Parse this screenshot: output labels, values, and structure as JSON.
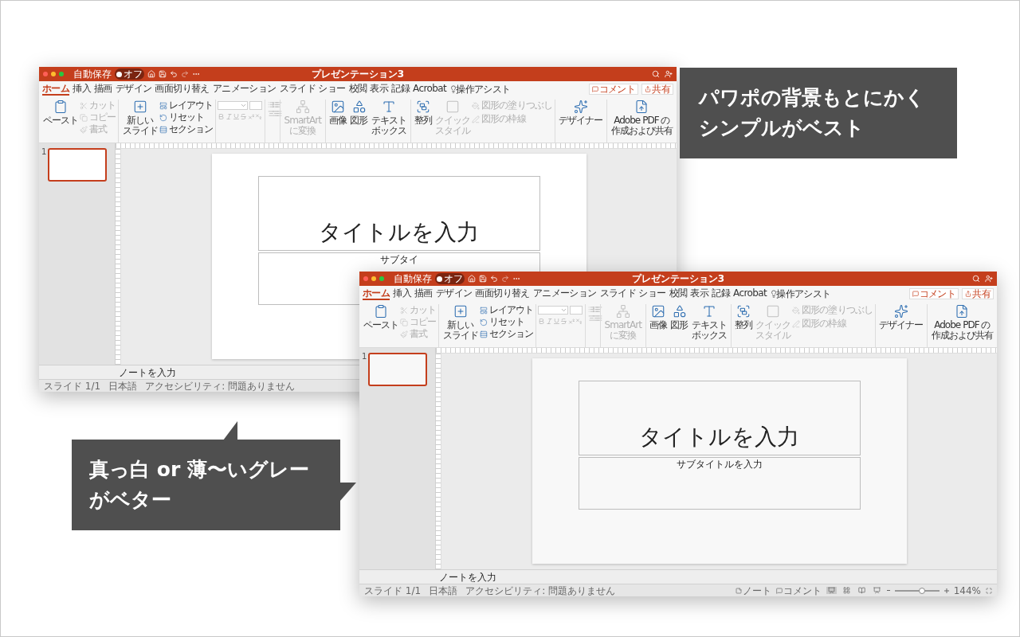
{
  "callouts": [
    {
      "lines": [
        "パワポの背景もとにかく",
        "シンプルがベスト"
      ]
    },
    {
      "lines": [
        "真っ白 or 薄〜いグレー",
        "がベター"
      ]
    }
  ],
  "windows": [
    {
      "title": "プレゼンテーション3",
      "autosave": {
        "label": "自動保存",
        "state": "オフ",
        "on": false
      },
      "tabs": [
        {
          "label": "ホーム",
          "selected": true
        },
        {
          "label": "挿入",
          "selected": false
        },
        {
          "label": "描画",
          "selected": false
        },
        {
          "label": "デザイン",
          "selected": false
        },
        {
          "label": "画面切り替え",
          "selected": false
        },
        {
          "label": "アニメーション",
          "selected": false
        },
        {
          "label": "スライド ショー",
          "selected": false
        },
        {
          "label": "校閲",
          "selected": false
        },
        {
          "label": "表示",
          "selected": false
        },
        {
          "label": "記録",
          "selected": false
        },
        {
          "label": "Acrobat",
          "selected": false
        }
      ],
      "assist": "操作アシスト",
      "comment_button": "コメント",
      "share_button": "共有",
      "ribbon": {
        "paste": {
          "label": "ペースト"
        },
        "clipboard": [
          {
            "label": "カット",
            "disabled": true
          },
          {
            "label": "コピー",
            "disabled": true
          },
          {
            "label": "書式",
            "disabled": true
          }
        ],
        "new_slide": {
          "lines": [
            "新しい",
            "スライド"
          ]
        },
        "slide_tools": [
          {
            "label": "レイアウト",
            "disabled": false
          },
          {
            "label": "リセット",
            "disabled": false
          },
          {
            "label": "セクション",
            "disabled": false
          }
        ],
        "smartart": {
          "lines": [
            "SmartArt",
            "に変換"
          ],
          "disabled": true
        },
        "insert": [
          {
            "lines": [
              "画像"
            ]
          },
          {
            "lines": [
              "図形"
            ]
          },
          {
            "lines": [
              "テキスト",
              "ボックス"
            ]
          }
        ],
        "arrange": {
          "lines": [
            "整列"
          ]
        },
        "quick_style": {
          "lines": [
            "クイック",
            "スタイル"
          ],
          "disabled": true
        },
        "shape_format": [
          {
            "label": "図形の塗りつぶし",
            "disabled": true
          },
          {
            "label": "図形の枠線",
            "disabled": true
          }
        ],
        "designer": {
          "lines": [
            "デザイナー"
          ]
        },
        "adobe": {
          "lines": [
            "Adobe PDF の",
            "作成および共有"
          ]
        }
      },
      "slide_number": "1",
      "thumb_selected": true,
      "slide": {
        "title": "タイトルを入力",
        "subtitle": "サブタイ",
        "color": "#ffffff"
      },
      "notes": "ノートを入力",
      "status": {
        "slide": "スライド 1/1",
        "language": "日本語",
        "accessibility": "アクセシビリティ: 問題ありません"
      }
    },
    {
      "title": "プレゼンテーション3",
      "autosave": {
        "label": "自動保存",
        "state": "オフ",
        "on": false
      },
      "tabs": [
        {
          "label": "ホーム",
          "selected": true
        },
        {
          "label": "挿入",
          "selected": false
        },
        {
          "label": "描画",
          "selected": false
        },
        {
          "label": "デザイン",
          "selected": false
        },
        {
          "label": "画面切り替え",
          "selected": false
        },
        {
          "label": "アニメーション",
          "selected": false
        },
        {
          "label": "スライド ショー",
          "selected": false
        },
        {
          "label": "校閲",
          "selected": false
        },
        {
          "label": "表示",
          "selected": false
        },
        {
          "label": "記録",
          "selected": false
        },
        {
          "label": "Acrobat",
          "selected": false
        }
      ],
      "assist": "操作アシスト",
      "comment_button": "コメント",
      "share_button": "共有",
      "ribbon": {
        "paste": {
          "label": "ペースト"
        },
        "clipboard": [
          {
            "label": "カット",
            "disabled": true
          },
          {
            "label": "コピー",
            "disabled": true
          },
          {
            "label": "書式",
            "disabled": true
          }
        ],
        "new_slide": {
          "lines": [
            "新しい",
            "スライド"
          ]
        },
        "slide_tools": [
          {
            "label": "レイアウト",
            "disabled": false
          },
          {
            "label": "リセット",
            "disabled": false
          },
          {
            "label": "セクション",
            "disabled": false
          }
        ],
        "smartart": {
          "lines": [
            "SmartArt",
            "に変換"
          ],
          "disabled": true
        },
        "insert": [
          {
            "lines": [
              "画像"
            ]
          },
          {
            "lines": [
              "図形"
            ]
          },
          {
            "lines": [
              "テキスト",
              "ボックス"
            ]
          }
        ],
        "arrange": {
          "lines": [
            "整列"
          ]
        },
        "quick_style": {
          "lines": [
            "クイック",
            "スタイル"
          ],
          "disabled": true
        },
        "shape_format": [
          {
            "label": "図形の塗りつぶし",
            "disabled": true
          },
          {
            "label": "図形の枠線",
            "disabled": true
          }
        ],
        "designer": {
          "lines": [
            "デザイナー"
          ]
        },
        "adobe": {
          "lines": [
            "Adobe PDF の",
            "作成および共有"
          ]
        }
      },
      "slide_number": "1",
      "thumb_selected": true,
      "slide": {
        "title": "タイトルを入力",
        "subtitle": "サブタイトルを入力",
        "color": "#f8f8f8"
      },
      "notes": "ノートを入力",
      "status": {
        "slide": "スライド 1/1",
        "language": "日本語",
        "accessibility": "アクセシビリティ: 問題ありません",
        "notes_button": "ノート",
        "comments_button": "コメント",
        "views": [
          {
            "selected": true
          },
          {
            "selected": false
          },
          {
            "selected": false
          },
          {
            "selected": false
          }
        ],
        "zoom": {
          "level": 0.62,
          "reading": "144%"
        }
      }
    }
  ]
}
